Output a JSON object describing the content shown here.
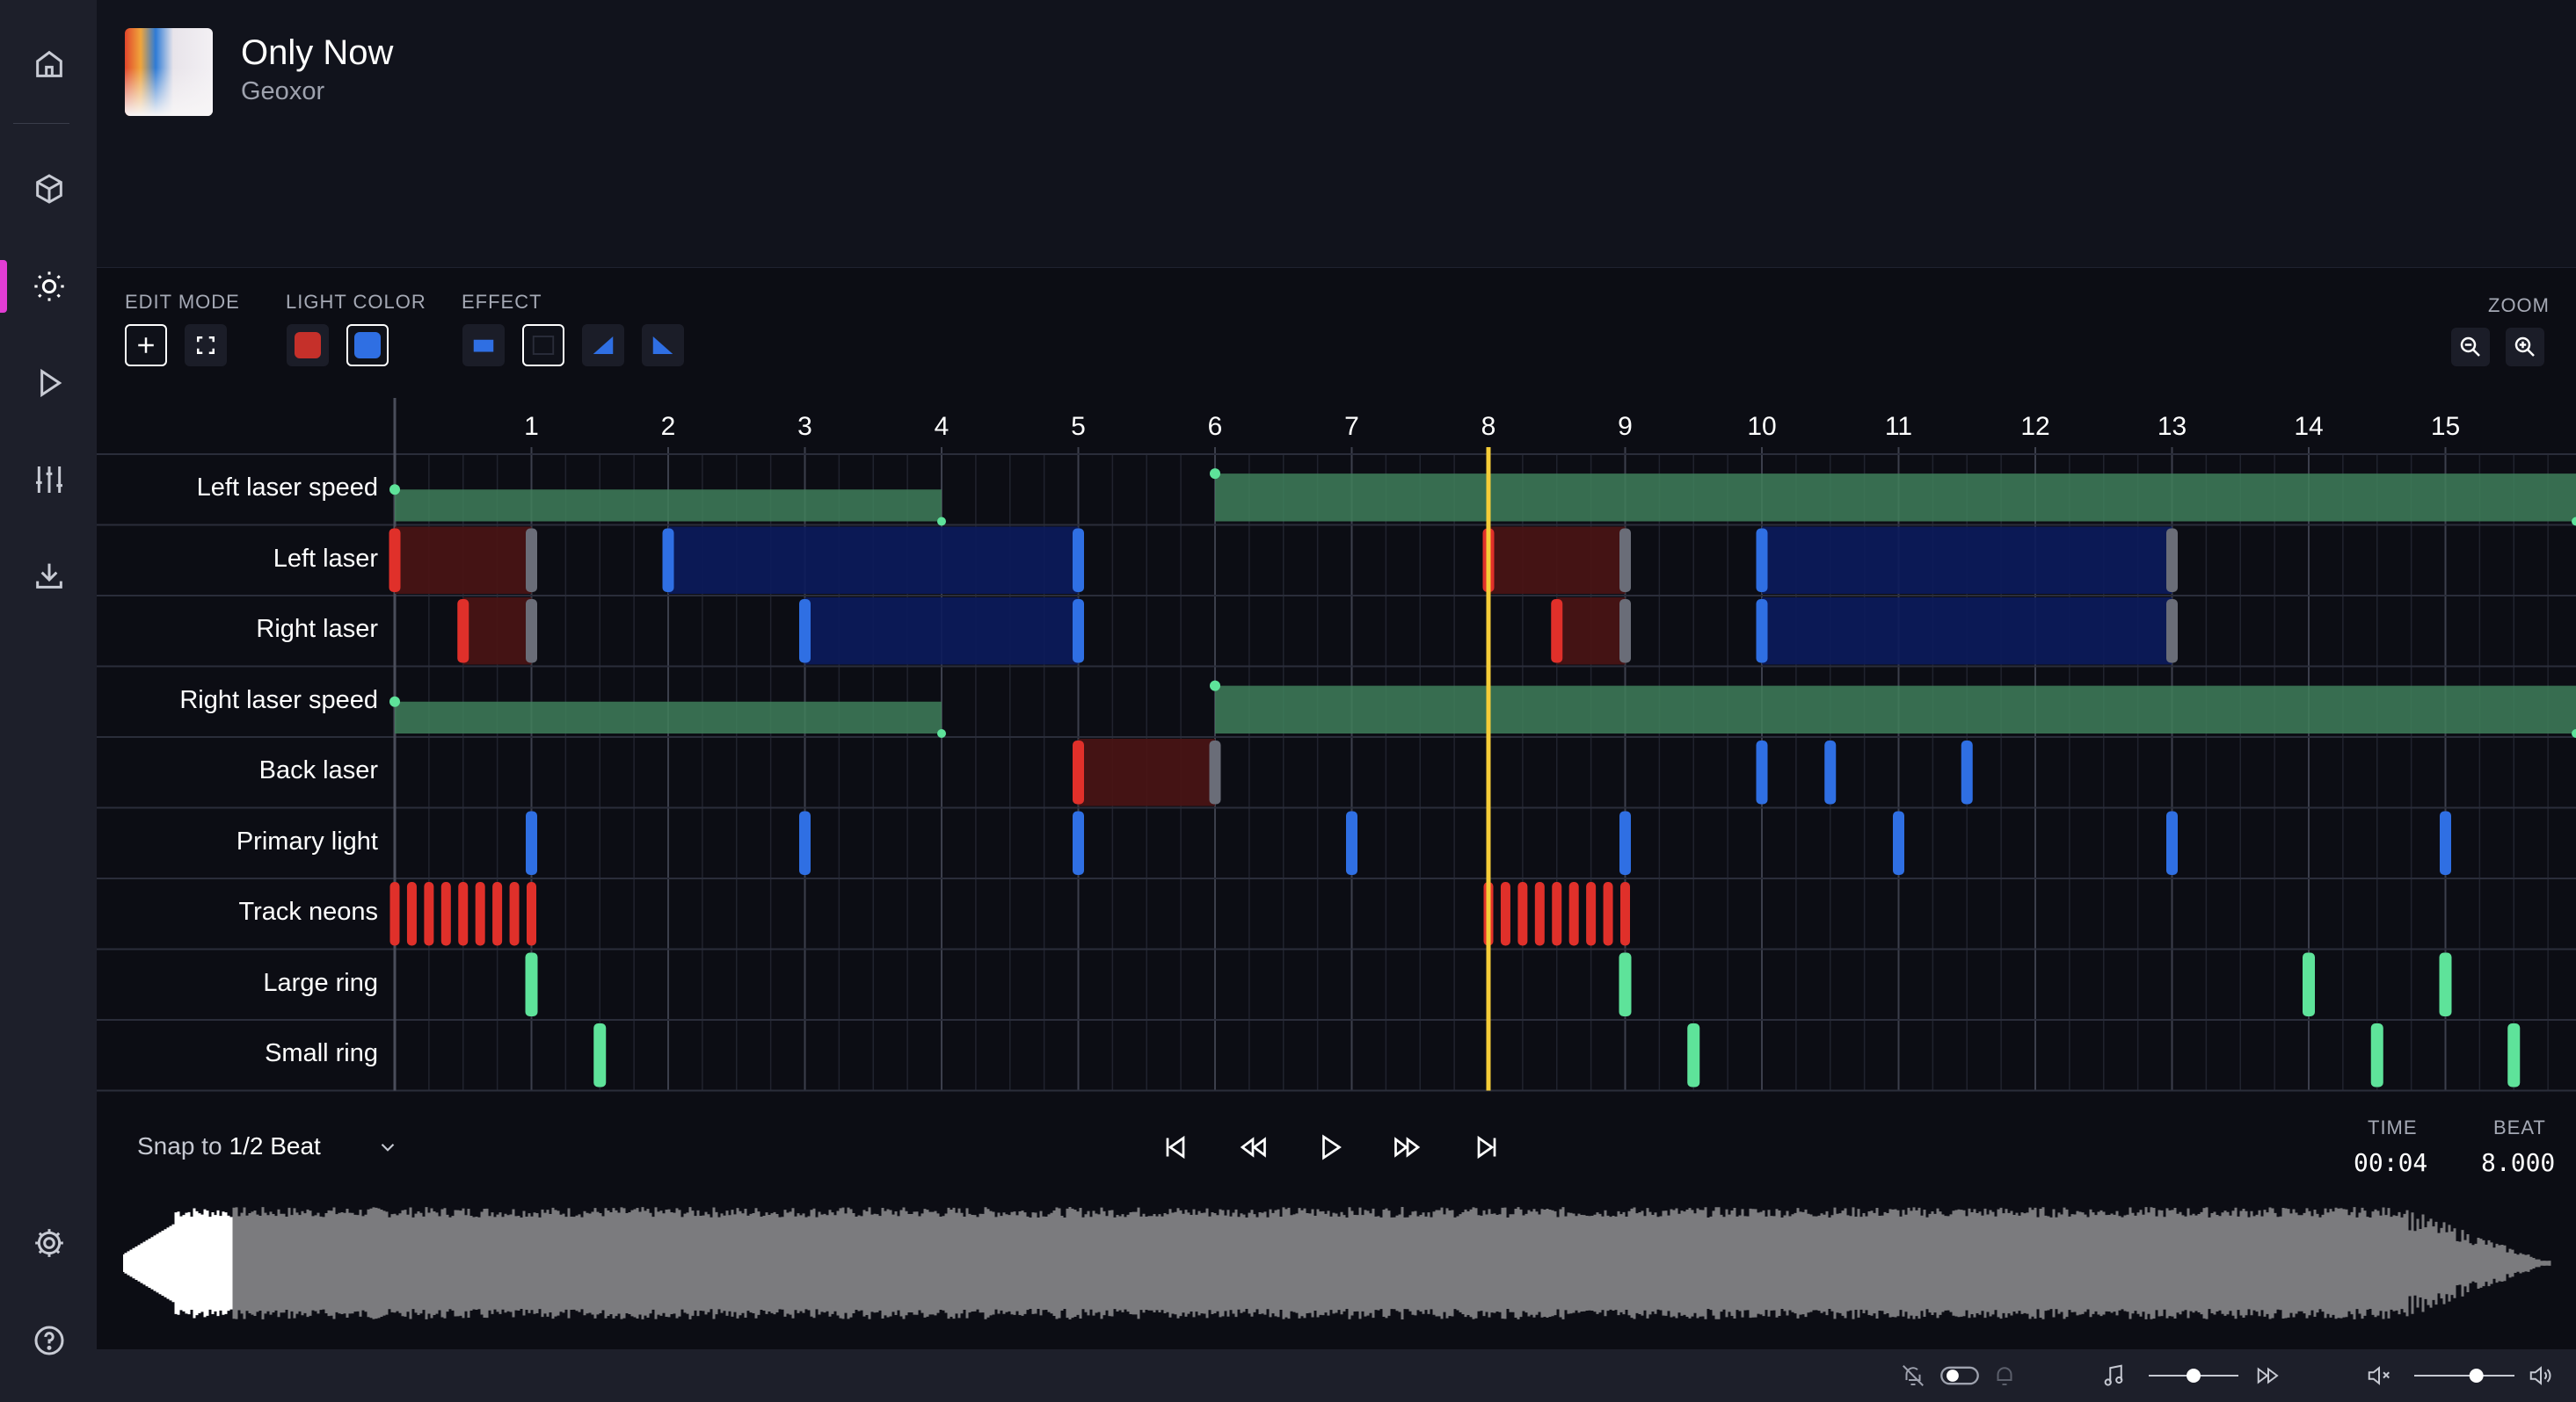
{
  "sidebar": {
    "items": [
      {
        "icon": "home-icon"
      },
      {
        "icon": "cube-icon"
      },
      {
        "icon": "sun-icon",
        "active": true
      },
      {
        "icon": "play-icon"
      },
      {
        "icon": "sliders-icon"
      },
      {
        "icon": "download-icon"
      }
    ],
    "bottom": [
      {
        "icon": "gear-icon"
      },
      {
        "icon": "help-icon"
      }
    ],
    "accent_color": "#e23dd4"
  },
  "song": {
    "title": "Only Now",
    "artist": "Geoxor"
  },
  "toolbar": {
    "edit_mode_label": "EDIT MODE",
    "light_color_label": "LIGHT COLOR",
    "effect_label": "EFFECT",
    "zoom_label": "ZOOM",
    "edit_modes": [
      {
        "icon": "plus-icon",
        "selected": true
      },
      {
        "icon": "select-box-icon",
        "selected": false
      }
    ],
    "light_colors": [
      {
        "color": "#c5302a",
        "selected": false
      },
      {
        "color": "#2f6fe3",
        "selected": true
      }
    ],
    "effects": [
      {
        "icon": "effect-on-icon"
      },
      {
        "icon": "effect-off-icon",
        "selected": true
      },
      {
        "icon": "effect-fade-in-icon"
      },
      {
        "icon": "effect-fade-out-icon"
      }
    ],
    "zoom": [
      {
        "icon": "zoom-out-icon"
      },
      {
        "icon": "zoom-in-icon"
      }
    ]
  },
  "timeline": {
    "beat_labels": [
      "1",
      "2",
      "3",
      "4",
      "5",
      "6",
      "7",
      "8",
      "9",
      "10",
      "11",
      "12",
      "13",
      "14",
      "15"
    ],
    "cursor_beat": 8,
    "colors": {
      "red": "#e0302a",
      "blue": "#2f6fe3",
      "off": "#6a6d78",
      "green": "#5ee39a",
      "cursor": "#f5cc38"
    },
    "tracks": [
      {
        "name": "Left laser speed",
        "kind": "speed",
        "segments": [
          [
            0,
            4,
            0.5
          ],
          [
            6,
            15.97,
            0.75
          ]
        ]
      },
      {
        "name": "Left laser",
        "kind": "light",
        "events": [
          [
            0,
            "red"
          ],
          [
            1,
            "off"
          ],
          [
            2,
            "blue"
          ],
          [
            5,
            "blue"
          ],
          [
            8,
            "red"
          ],
          [
            9,
            "off"
          ],
          [
            10,
            "blue"
          ],
          [
            13,
            "off"
          ]
        ],
        "fills": [
          [
            0,
            1,
            "red"
          ],
          [
            2,
            5,
            "blue"
          ],
          [
            8,
            9,
            "red"
          ],
          [
            10,
            13,
            "blue"
          ]
        ]
      },
      {
        "name": "Right laser",
        "kind": "light",
        "events": [
          [
            0.5,
            "red"
          ],
          [
            1,
            "off"
          ],
          [
            3,
            "blue"
          ],
          [
            5,
            "blue"
          ],
          [
            8.5,
            "red"
          ],
          [
            9,
            "off"
          ],
          [
            10,
            "blue"
          ],
          [
            13,
            "off"
          ]
        ],
        "fills": [
          [
            0.5,
            1,
            "red"
          ],
          [
            3,
            5,
            "blue"
          ],
          [
            8.5,
            9,
            "red"
          ],
          [
            10,
            13,
            "blue"
          ]
        ]
      },
      {
        "name": "Right laser speed",
        "kind": "speed",
        "segments": [
          [
            0,
            4,
            0.5
          ],
          [
            6,
            15.97,
            0.75
          ]
        ]
      },
      {
        "name": "Back laser",
        "kind": "light",
        "events": [
          [
            5,
            "red"
          ],
          [
            6,
            "off"
          ],
          [
            10,
            "blue"
          ],
          [
            10.5,
            "blue"
          ],
          [
            11.5,
            "blue"
          ]
        ],
        "fills": [
          [
            5,
            6,
            "red"
          ]
        ]
      },
      {
        "name": "Primary light",
        "kind": "light",
        "events": [
          [
            1,
            "blue"
          ],
          [
            3,
            "blue"
          ],
          [
            5,
            "blue"
          ],
          [
            7,
            "blue"
          ],
          [
            9,
            "blue"
          ],
          [
            11,
            "blue"
          ],
          [
            13,
            "blue"
          ],
          [
            15,
            "blue"
          ]
        ],
        "fills": []
      },
      {
        "name": "Track neons",
        "kind": "light",
        "events": [
          [
            0,
            "red"
          ],
          [
            0.125,
            "red"
          ],
          [
            0.25,
            "red"
          ],
          [
            0.375,
            "red"
          ],
          [
            0.5,
            "red"
          ],
          [
            0.625,
            "red"
          ],
          [
            0.75,
            "red"
          ],
          [
            0.875,
            "red"
          ],
          [
            1,
            "red"
          ],
          [
            8,
            "red"
          ],
          [
            8.125,
            "red"
          ],
          [
            8.25,
            "red"
          ],
          [
            8.375,
            "red"
          ],
          [
            8.5,
            "red"
          ],
          [
            8.625,
            "red"
          ],
          [
            8.75,
            "red"
          ],
          [
            8.875,
            "red"
          ],
          [
            9,
            "red"
          ]
        ],
        "fills": []
      },
      {
        "name": "Large ring",
        "kind": "ring",
        "events": [
          1,
          9,
          14,
          15
        ]
      },
      {
        "name": "Small ring",
        "kind": "ring",
        "events": [
          1.5,
          9.5,
          14.5,
          15.5
        ]
      }
    ]
  },
  "transport": {
    "snap_label": "Snap to",
    "snap_value": "1/2 Beat",
    "buttons": [
      {
        "icon": "skip-start-icon"
      },
      {
        "icon": "rewind-icon"
      },
      {
        "icon": "play-icon"
      },
      {
        "icon": "fast-forward-icon"
      },
      {
        "icon": "skip-end-icon"
      }
    ],
    "time_label": "TIME",
    "time_value": "00:04",
    "beat_label": "BEAT",
    "beat_value": "8.000",
    "waveform_played_fraction": 0.045
  },
  "statusbar": {
    "icons": [
      "bell-off-icon",
      "toggle-icon",
      "bell-icon",
      "music-note-icon",
      "speed-slider-icon",
      "fast-forward-small-icon",
      "mute-icon",
      "volume-slider-icon",
      "volume-icon"
    ],
    "playback_speed_fraction": 0.5,
    "volume_fraction": 0.62
  }
}
